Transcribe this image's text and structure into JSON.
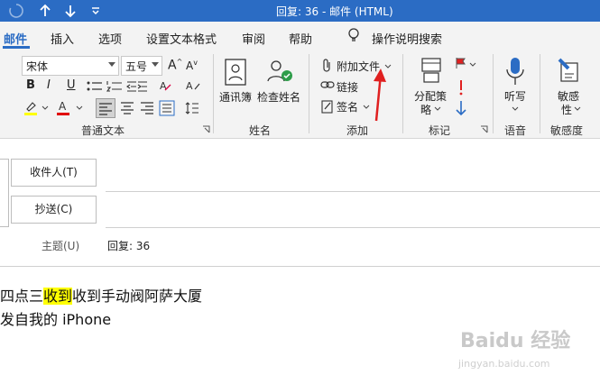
{
  "window": {
    "title": "回复: 36  -  邮件 (HTML)"
  },
  "menu": {
    "items": [
      "邮件",
      "插入",
      "选项",
      "设置文本格式",
      "审阅",
      "帮助"
    ],
    "search": "操作说明搜索"
  },
  "ribbon": {
    "font_name": "宋体",
    "font_size": "五号",
    "bold": "B",
    "italic": "I",
    "underline": "U",
    "groups": {
      "basic_text": "普通文本",
      "names": "姓名",
      "add": "添加",
      "tags": "标记",
      "voice": "语音",
      "sensitivity": "敏感度"
    },
    "address_book": "通讯簿",
    "check_names": "检查姓名",
    "attach_file": "附加文件",
    "link": "链接",
    "signature": "签名",
    "assign_policy_1": "分配策",
    "assign_policy_2": "略",
    "dictate": "听写",
    "sensitivity_1": "敏感",
    "sensitivity_2": "性"
  },
  "compose": {
    "to_button": "收件人(T)",
    "cc_button": "抄送(C)",
    "subject_label": "主题(U)",
    "subject_value": "回复: 36",
    "body_line1_pre": "四点三",
    "body_line1_hl": "收到",
    "body_line1_post": "收到手动阀阿萨大厦",
    "body_line2": "发自我的 iPhone"
  },
  "watermark": {
    "brand": "Baidu 经验",
    "url": "jingyan.baidu.com"
  },
  "colors": {
    "accent": "#2b6cc4",
    "highlight": "#ffff00",
    "font_red": "#e00000",
    "annotation_arrow": "#e02020"
  }
}
